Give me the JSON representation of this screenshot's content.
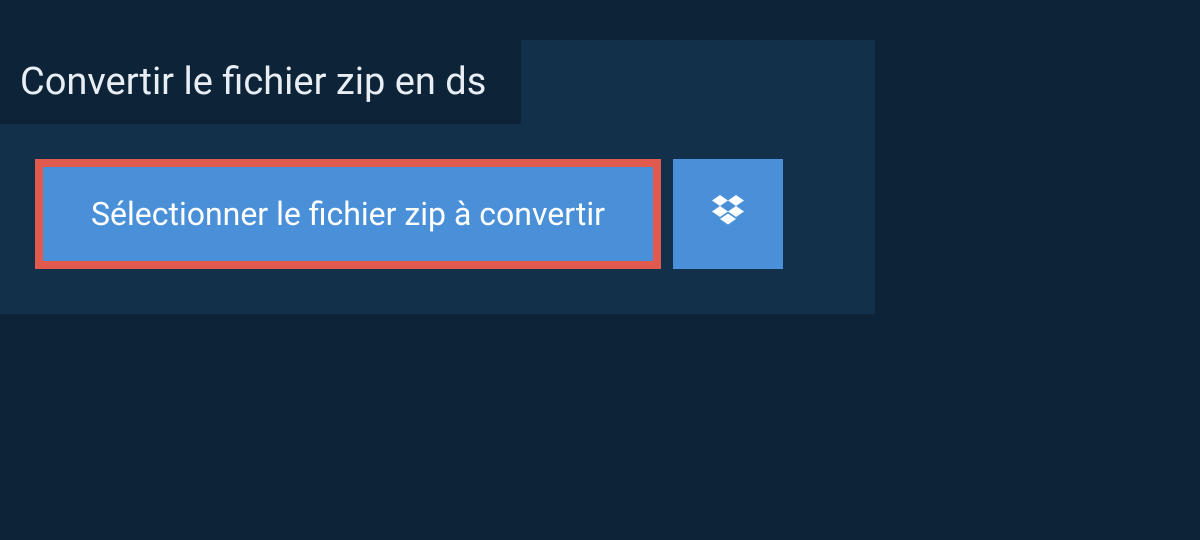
{
  "header": {
    "title": "Convertir le fichier zip en ds"
  },
  "actions": {
    "select_file_label": "Sélectionner le fichier zip à convertir"
  },
  "colors": {
    "background": "#0d2438",
    "panel": "#13304a",
    "button": "#4a90d9",
    "highlight_border": "#e15a4e",
    "text_light": "#e8eef3"
  }
}
